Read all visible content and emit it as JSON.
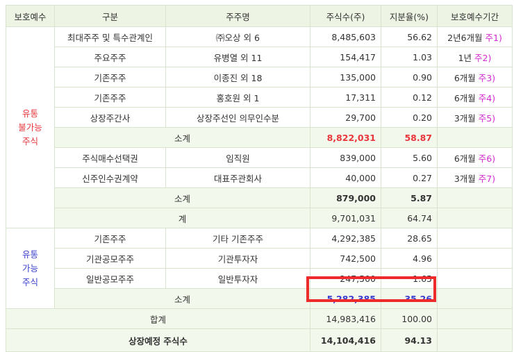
{
  "headers": [
    "보호예수",
    "구분",
    "주주명",
    "주식수(주)",
    "지분율(%)",
    "보호예수기간"
  ],
  "group_locked": "유통\n불가능\n주식",
  "group_free": "유통\n가능\n주식",
  "locked_rows": [
    {
      "type": "최대주주 및 특수관계인",
      "holder": "㈜오상 외 6",
      "shares": "8,485,603",
      "ratio": "56.62",
      "period": "2년6개월",
      "note": "주1)"
    },
    {
      "type": "주요주주",
      "holder": "유병열 외 11",
      "shares": "154,417",
      "ratio": "1.03",
      "period": "1년",
      "note": "주2)"
    },
    {
      "type": "기존주주",
      "holder": "이종진 외 18",
      "shares": "135,000",
      "ratio": "0.90",
      "period": "6개월",
      "note": "주3)"
    },
    {
      "type": "기존주주",
      "holder": "홍호원 외 1",
      "shares": "17,311",
      "ratio": "0.12",
      "period": "6개월",
      "note": "주4)"
    },
    {
      "type": "상장주간사",
      "holder": "상장주선인 의무인수분",
      "shares": "29,700",
      "ratio": "0.20",
      "period": "3개월",
      "note": "주5)"
    }
  ],
  "locked_subtotal1": {
    "label": "소계",
    "shares": "8,822,031",
    "ratio": "58.87"
  },
  "locked_rows2": [
    {
      "type": "주식매수선택권",
      "holder": "임직원",
      "shares": "839,000",
      "ratio": "5.60",
      "period": "6개월",
      "note": "주6)"
    },
    {
      "type": "신주인수권계약",
      "holder": "대표주관회사",
      "shares": "40,000",
      "ratio": "0.27",
      "period": "3개월",
      "note": "주7)"
    }
  ],
  "locked_subtotal2": {
    "label": "소계",
    "shares": "879,000",
    "ratio": "5.87"
  },
  "locked_total": {
    "label": "계",
    "shares": "9,701,031",
    "ratio": "64.74"
  },
  "free_rows": [
    {
      "type": "기존주주",
      "holder": "기타 기존주주",
      "shares": "4,292,385",
      "ratio": "28.65"
    },
    {
      "type": "기관공모주주",
      "holder": "기관투자자",
      "shares": "742,500",
      "ratio": "4.96"
    },
    {
      "type": "일반공모주주",
      "holder": "일반투자자",
      "shares": "247,500",
      "ratio": "1.65"
    }
  ],
  "free_subtotal": {
    "label": "소계",
    "shares": "5,282,385",
    "ratio": "35.26"
  },
  "grand_total": {
    "label": "합계",
    "shares": "14,983,416",
    "ratio": "100.00"
  },
  "listed": {
    "label": "상장예정 주식수",
    "shares": "14,104,416",
    "ratio": "94.13"
  },
  "colors": {
    "header_bg": "#eef4e4",
    "border": "#d9e4cf",
    "red": "#e8363b",
    "blue": "#3b3fcf",
    "note": "#d42bd0",
    "highlight": "#ee2b2b"
  }
}
